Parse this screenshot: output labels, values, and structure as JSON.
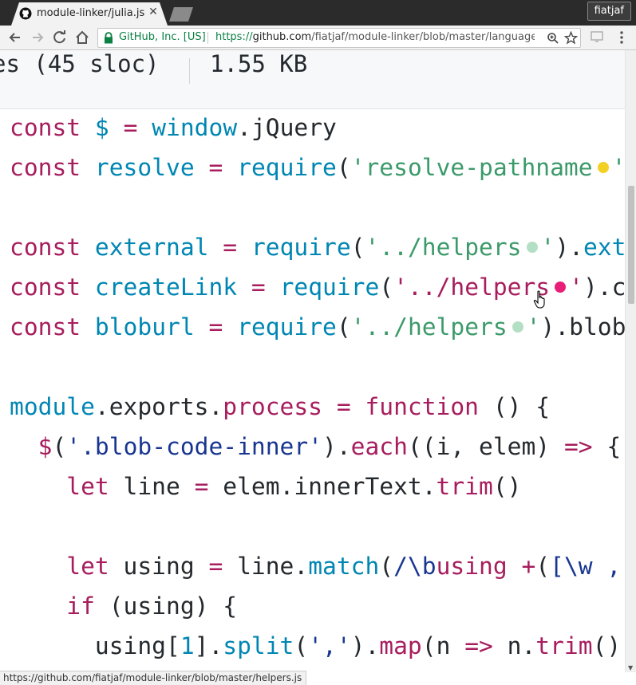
{
  "browser": {
    "tab_title": "module-linker/julia.js",
    "profile_name": "fiatjaf",
    "site_identity": "GitHub, Inc. [US]",
    "url_protocol": "https://",
    "url_host": "github.com",
    "url_path": "/fiatjaf/module-linker/blob/master/languages/julia.js"
  },
  "file_info": {
    "lines": "es (45 sloc)",
    "size": "1.55 KB"
  },
  "code_lines": [
    "const $ = window.jQuery",
    "const resolve = require('resolve-pathname",
    "",
    "const external = require('../helpers').ext",
    "const createLink = require('../helpers').c",
    "const bloburl = require('../helpers').blob",
    "",
    "module.exports.process = function () {",
    "  $('.blob-code-inner').each((i, elem) => {",
    "    let line = elem.innerText.trim()",
    "",
    "    let using = line.match(/\\busing +([\\w ,",
    "    if (using) {",
    "      using[1].split(',').map(n => n.trim()"
  ],
  "status_url": "https://github.com/fiatjaf/module-linker/blob/master/helpers.js",
  "colors": {
    "keyword": "#a71d5d",
    "function": "#0086b3",
    "string": "#183691",
    "string_link": "#3c9a6a",
    "dot_yellow": "#f2d024",
    "dot_green": "#b3dfc4",
    "dot_pink": "#e91e78"
  }
}
